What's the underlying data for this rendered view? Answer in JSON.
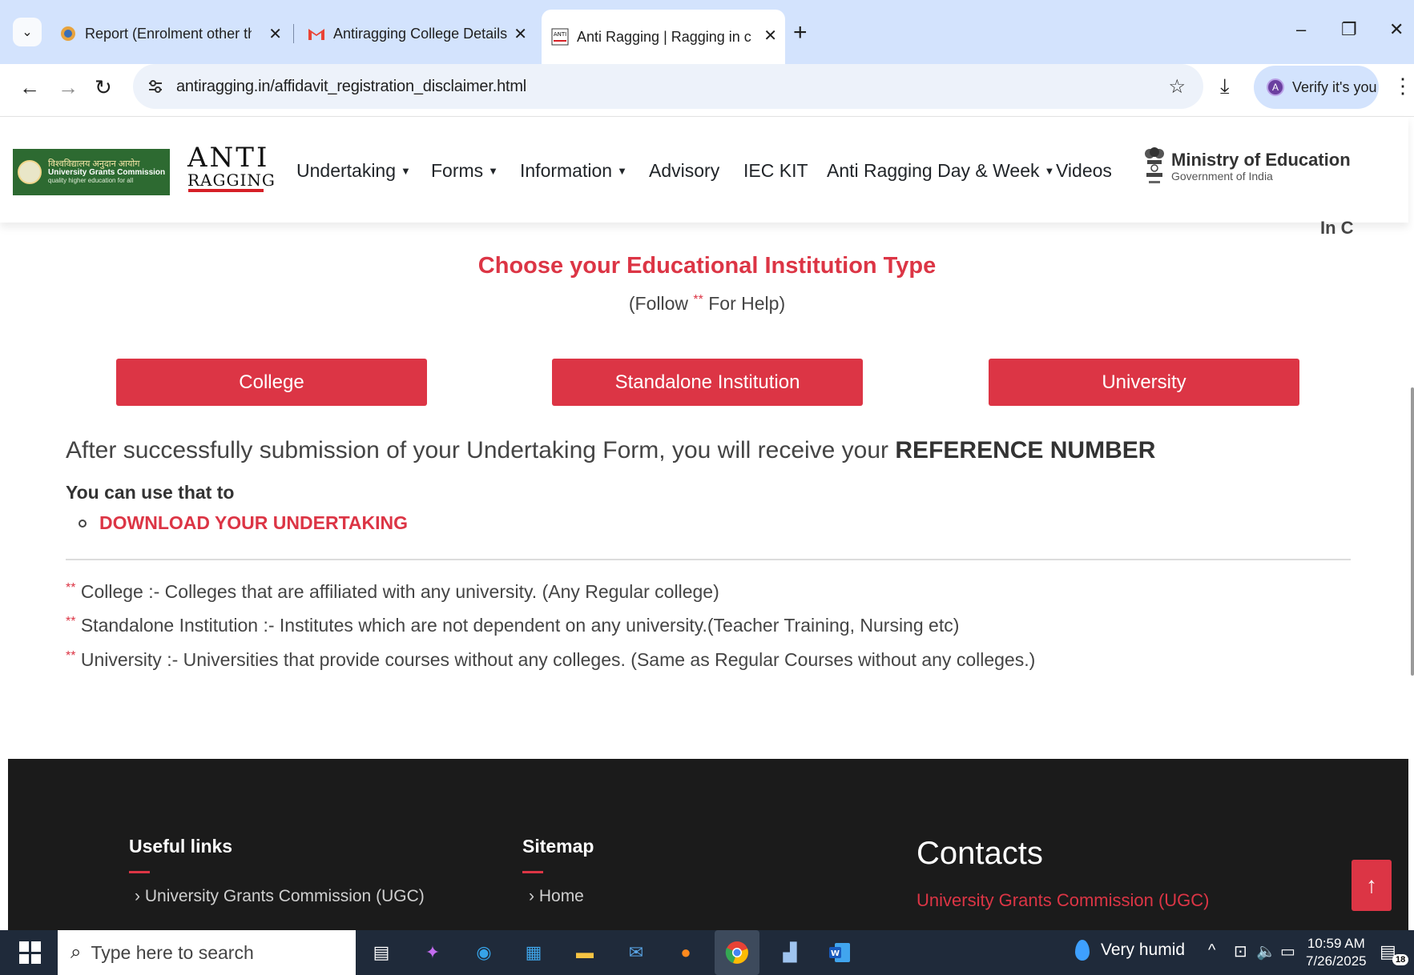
{
  "browser": {
    "tabs": [
      {
        "title": "Report (Enrolment other than M",
        "icon": "report-favicon"
      },
      {
        "title": "Antiragging College Details - re",
        "icon": "gmail-favicon"
      },
      {
        "title": "Anti Ragging | Ragging in colleg",
        "icon": "antiragging-favicon"
      }
    ],
    "close_glyph": "✕",
    "new_tab": "+",
    "url": "antiragging.in/affidavit_registration_disclaimer.html",
    "verify_label": "Verify it's you",
    "avatar_initial": "A",
    "minimize": "–",
    "restore": "❐",
    "close": "✕"
  },
  "site": {
    "ugc_logo": {
      "line1": "विश्वविद्यालय अनुदान आयोग",
      "line2": "University Grants Commission",
      "line3": "quality higher education for all"
    },
    "antiragging_logo": {
      "top": "ANTI",
      "bottom": "RAGGING"
    },
    "nav": [
      {
        "label": "Undertaking",
        "dropdown": true
      },
      {
        "label": "Forms",
        "dropdown": true
      },
      {
        "label": "Information",
        "dropdown": true
      },
      {
        "label": "Advisory",
        "dropdown": false
      },
      {
        "label": "IEC KIT",
        "dropdown": false
      },
      {
        "label": "Anti Ragging Day & Week",
        "dropdown": true
      },
      {
        "label": "Videos",
        "dropdown": false
      }
    ],
    "moe": {
      "title": "Ministry of Education",
      "subtitle": "Government of India"
    }
  },
  "main": {
    "clipped_text": "In C",
    "title": "Choose your Educational Institution Type",
    "help_prefix": "(Follow ",
    "help_star": "**",
    "help_suffix": " For Help)",
    "buttons": [
      "College",
      "Standalone Institution",
      "University"
    ],
    "ref_text": "After successfully submission of your Undertaking Form, you will receive your ",
    "ref_bold": "REFERENCE NUMBER",
    "use_that": "You can use that to",
    "download_link": "DOWNLOAD YOUR UNDERTAKING",
    "definitions": [
      "College :- Colleges that are affiliated with any university. (Any Regular college)",
      "Standalone Institution :- Institutes which are not dependent on any university.(Teacher Training, Nursing etc)",
      "University :- Universities that provide courses without any colleges. (Same as Regular Courses without any colleges.)"
    ],
    "def_star": "**"
  },
  "footer": {
    "useful_links_title": "Useful links",
    "useful_links": [
      "University Grants Commission (UGC)"
    ],
    "sitemap_title": "Sitemap",
    "sitemap": [
      "Home"
    ],
    "contacts_title": "Contacts",
    "contacts_org": "University Grants Commission (UGC)"
  },
  "taskbar": {
    "search_placeholder": "Type here to search",
    "weather": "Very humid",
    "time": "10:59 AM",
    "date": "7/26/2025",
    "notifications": "18"
  },
  "colors": {
    "accent": "#dc3545",
    "footer_bg": "#1b1b1b",
    "chrome_bg": "#d3e3fd"
  }
}
